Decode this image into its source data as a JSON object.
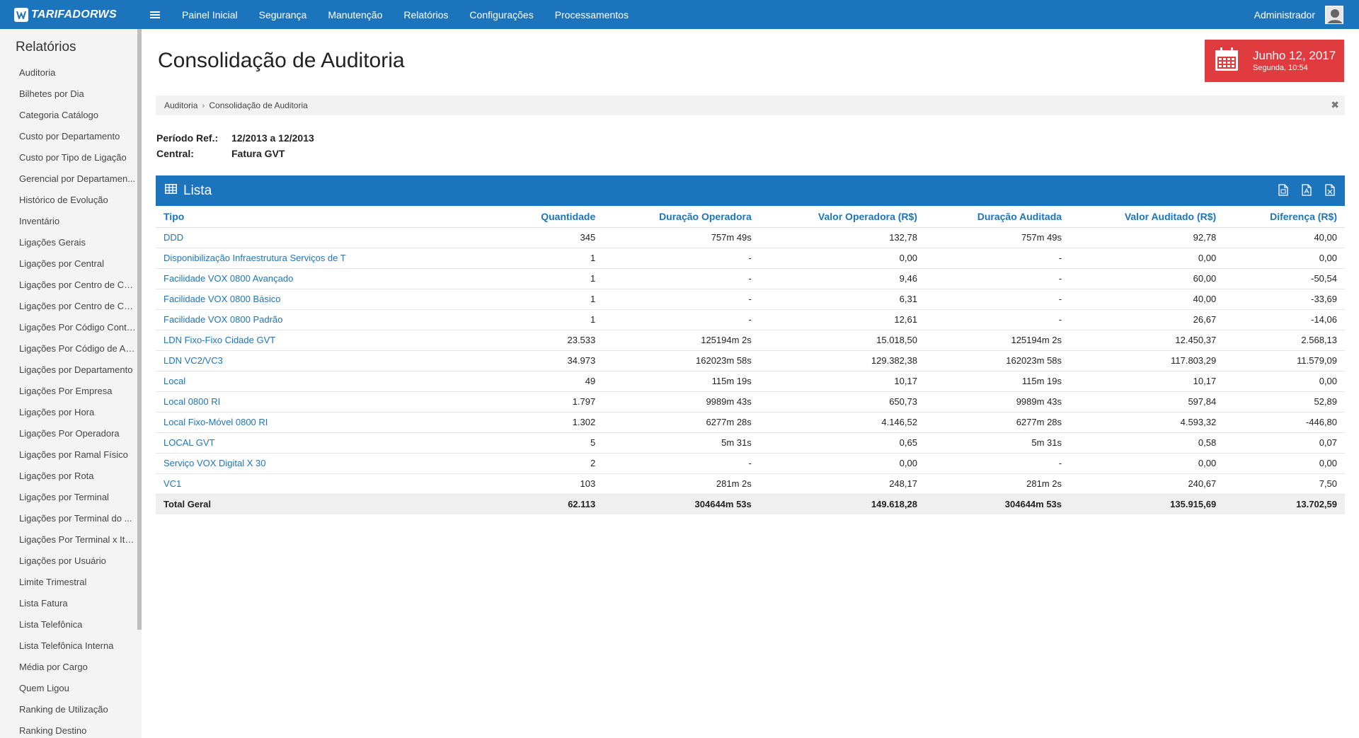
{
  "app": {
    "logo_text": "TARIFADORWS",
    "nav": [
      "Painel Inicial",
      "Segurança",
      "Manutenção",
      "Relatórios",
      "Configurações",
      "Processamentos"
    ],
    "user_name": "Administrador"
  },
  "sidebar": {
    "title": "Relatórios",
    "items": [
      "Auditoria",
      "Bilhetes por Dia",
      "Categoria Catálogo",
      "Custo por Departamento",
      "Custo por Tipo de Ligação",
      "Gerencial por Departamen...",
      "Histórico de Evolução",
      "Inventário",
      "Ligações Gerais",
      "Ligações por Central",
      "Ligações por Centro de Cu...",
      "Ligações por Centro de Cu...",
      "Ligações Por Código Contá...",
      "Ligações Por Código de Ac...",
      "Ligações por Departamento",
      "Ligações Por Empresa",
      "Ligações por Hora",
      "Ligações Por Operadora",
      "Ligações por Ramal Físico",
      "Ligações por Rota",
      "Ligações por Terminal",
      "Ligações por Terminal do ...",
      "Ligações Por Terminal x Ite...",
      "Ligações por Usuário",
      "Limite Trimestral",
      "Lista Fatura",
      "Lista Telefônica",
      "Lista Telefônica Interna",
      "Média por Cargo",
      "Quem Ligou",
      "Ranking de Utilização",
      "Ranking Destino"
    ]
  },
  "page": {
    "title": "Consolidação de Auditoria",
    "date_main": "Junho 12, 2017",
    "date_sub": "Segunda, 10:54",
    "breadcrumb": [
      "Auditoria",
      "Consolidação de Auditoria"
    ],
    "close_symbol": "✖",
    "info": [
      {
        "label": "Período Ref.:",
        "value": "12/2013 a 12/2013"
      },
      {
        "label": "Central:",
        "value": "Fatura GVT"
      }
    ]
  },
  "panel": {
    "title": "Lista",
    "columns": [
      "Tipo",
      "Quantidade",
      "Duração Operadora",
      "Valor Operadora (R$)",
      "Duração Auditada",
      "Valor Auditado (R$)",
      "Diferença (R$)"
    ],
    "rows": [
      [
        "DDD",
        "345",
        "757m 49s",
        "132,78",
        "757m 49s",
        "92,78",
        "40,00"
      ],
      [
        "Disponibilização Infraestrutura Serviços de T",
        "1",
        "-",
        "0,00",
        "-",
        "0,00",
        "0,00"
      ],
      [
        "Facilidade VOX 0800 Avançado",
        "1",
        "-",
        "9,46",
        "-",
        "60,00",
        "-50,54"
      ],
      [
        "Facilidade VOX 0800 Básico",
        "1",
        "-",
        "6,31",
        "-",
        "40,00",
        "-33,69"
      ],
      [
        "Facilidade VOX 0800 Padrão",
        "1",
        "-",
        "12,61",
        "-",
        "26,67",
        "-14,06"
      ],
      [
        "LDN Fixo-Fixo Cidade GVT",
        "23.533",
        "125194m 2s",
        "15.018,50",
        "125194m 2s",
        "12.450,37",
        "2.568,13"
      ],
      [
        "LDN VC2/VC3",
        "34.973",
        "162023m 58s",
        "129.382,38",
        "162023m 58s",
        "117.803,29",
        "11.579,09"
      ],
      [
        "Local",
        "49",
        "115m 19s",
        "10,17",
        "115m 19s",
        "10,17",
        "0,00"
      ],
      [
        "Local 0800 RI",
        "1.797",
        "9989m 43s",
        "650,73",
        "9989m 43s",
        "597,84",
        "52,89"
      ],
      [
        "Local Fixo-Móvel 0800 RI",
        "1.302",
        "6277m 28s",
        "4.146,52",
        "6277m 28s",
        "4.593,32",
        "-446,80"
      ],
      [
        "LOCAL GVT",
        "5",
        "5m 31s",
        "0,65",
        "5m 31s",
        "0,58",
        "0,07"
      ],
      [
        "Serviço VOX Digital X 30",
        "2",
        "-",
        "0,00",
        "-",
        "0,00",
        "0,00"
      ],
      [
        "VC1",
        "103",
        "281m 2s",
        "248,17",
        "281m 2s",
        "240,67",
        "7,50"
      ]
    ],
    "total": [
      "Total Geral",
      "62.113",
      "304644m 53s",
      "149.618,28",
      "304644m 53s",
      "135.915,69",
      "13.702,59"
    ]
  }
}
